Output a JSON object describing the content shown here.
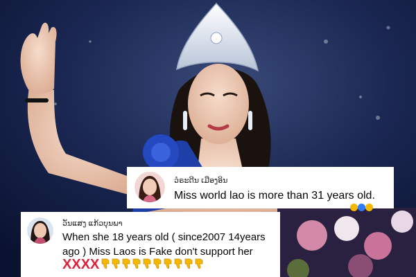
{
  "comment_1": {
    "author": "ວໍຣະດີນ ເມືອງອິນ",
    "text": "Miss world lao is more than 31 years old.",
    "reaction_icons": [
      "thumbs-down-icon",
      "sad-face-icon",
      "angry-face-icon"
    ]
  },
  "comment_2": {
    "author": "ວັນແສງ ແກ້ວບຸນພາ",
    "text": "When she 18 years old ( since2007 14years ago ) Miss Laos is Fake don't support her",
    "marks": [
      "X",
      "X",
      "X",
      "X"
    ],
    "thumbs_down_count": 10
  },
  "colors": {
    "bubble": "#f0f2f5",
    "cross": "#e0203a",
    "thumbs": "#f5b800",
    "gown_blue": "#1f3fa8",
    "background": "#0e1a3a"
  }
}
